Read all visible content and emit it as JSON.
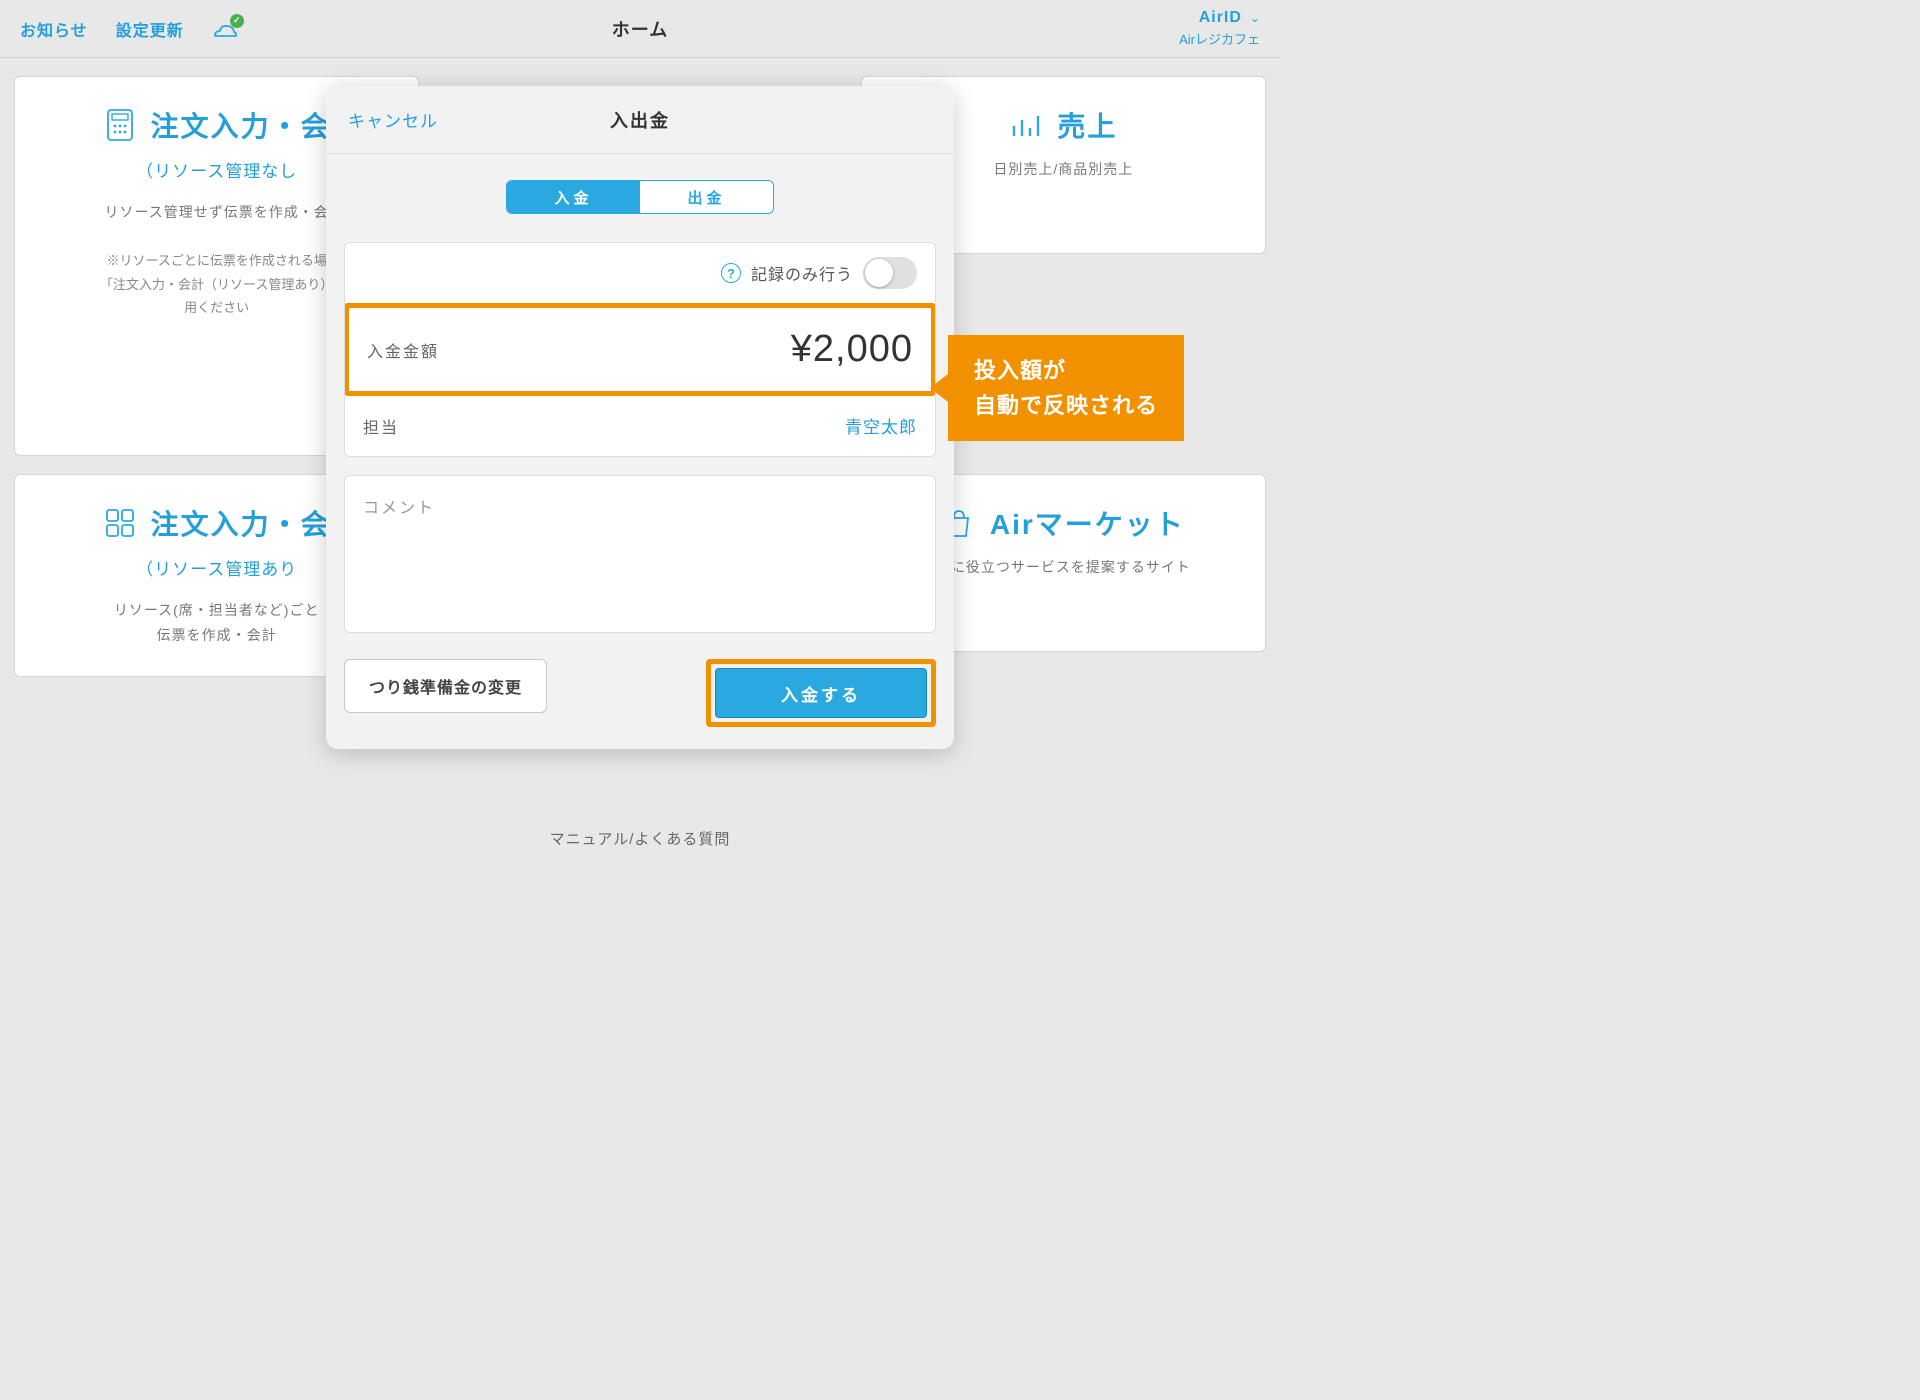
{
  "header": {
    "notice": "お知らせ",
    "settings": "設定更新",
    "title": "ホーム",
    "air_id": "AirID",
    "store": "Airレジカフェ"
  },
  "cards": {
    "order1_title": "注文入力・会",
    "order1_sub1": "（リソース管理なし",
    "order1_sub2": "リソース管理せず伝票を作成・会",
    "order1_note1": "※リソースごとに伝票を作成される場",
    "order1_note2": "「注文入力・会計（リソース管理あり）",
    "order1_note3": "用ください",
    "sales_title": "売上",
    "sales_sub": "日別売上/商品別売上",
    "market_title": "Airマーケット",
    "market_sub": "務に役立つサービスを提案するサイト",
    "order2_title": "注文入力・会",
    "order2_sub1": "（リソース管理あり",
    "order2_sub2a": "リソース(席・担当者など)ごと",
    "order2_sub2b": "伝票を作成・会計"
  },
  "modal": {
    "cancel": "キャンセル",
    "title": "入出金",
    "seg_in": "入金",
    "seg_out": "出金",
    "record_label": "記録のみ行う",
    "amount_label": "入金金額",
    "amount_value": "¥2,000",
    "owner_label": "担当",
    "owner_value": "青空太郎",
    "comment_label": "コメント",
    "btn_secondary": "つり銭準備金の変更",
    "btn_primary": "入金する"
  },
  "callout": {
    "line1": "投入額が",
    "line2": "自動で反映される"
  },
  "footer": {
    "manual": "マニュアル/よくある質問"
  }
}
